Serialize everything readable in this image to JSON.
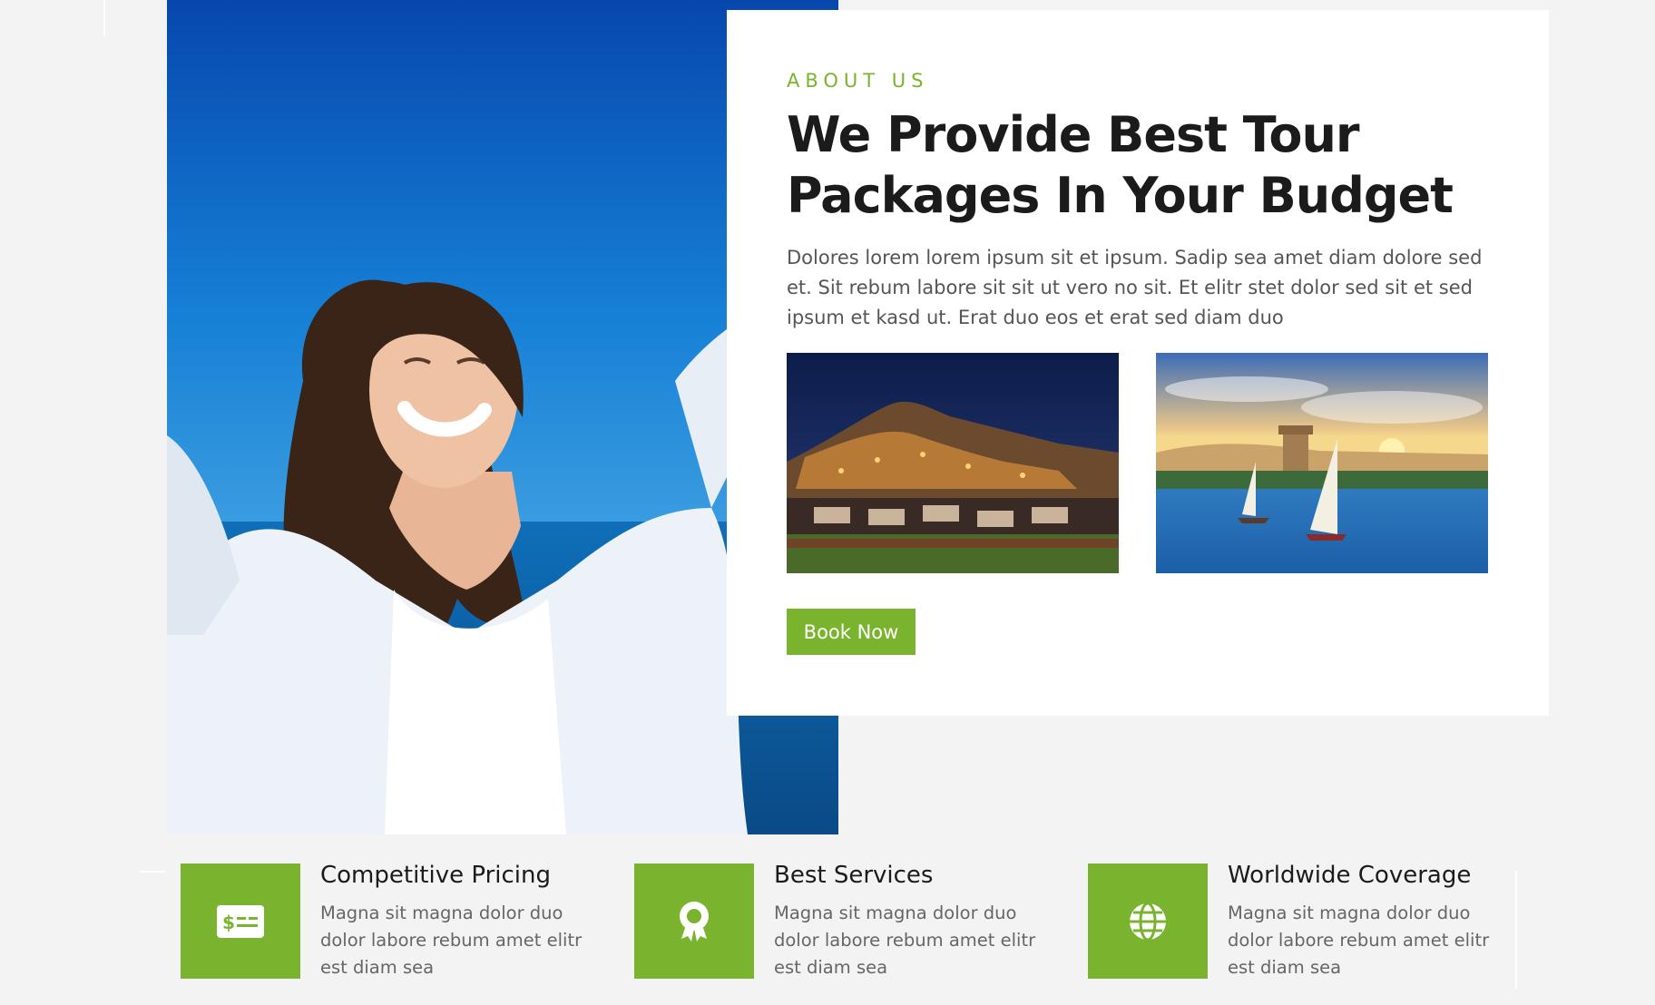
{
  "about": {
    "eyebrow": "ABOUT US",
    "title_line1": "We Provide Best Tour",
    "title_line2": "Packages In Your Budget",
    "body": "Dolores lorem lorem ipsum sit et ipsum. Sadip sea amet diam dolore sed et. Sit rebum labore sit sit ut vero no sit. Et elitr stet dolor sed sit et sed ipsum et kasd ut. Erat duo eos et erat sed diam duo",
    "book_button": "Book Now"
  },
  "features": [
    {
      "title": "Competitive Pricing",
      "text": "Magna sit magna dolor duo dolor labore rebum amet elitr est diam sea",
      "icon": "money-bill-icon"
    },
    {
      "title": "Best Services",
      "text": "Magna sit magna dolor duo dolor labore rebum amet elitr est diam sea",
      "icon": "award-icon"
    },
    {
      "title": "Worldwide Coverage",
      "text": "Magna sit magna dolor duo dolor labore rebum amet elitr est diam sea",
      "icon": "globe-icon"
    }
  ],
  "colors": {
    "accent": "#7ab32e",
    "heading": "#1b1b1b",
    "text": "#555555",
    "background": "#f3f3f3"
  }
}
